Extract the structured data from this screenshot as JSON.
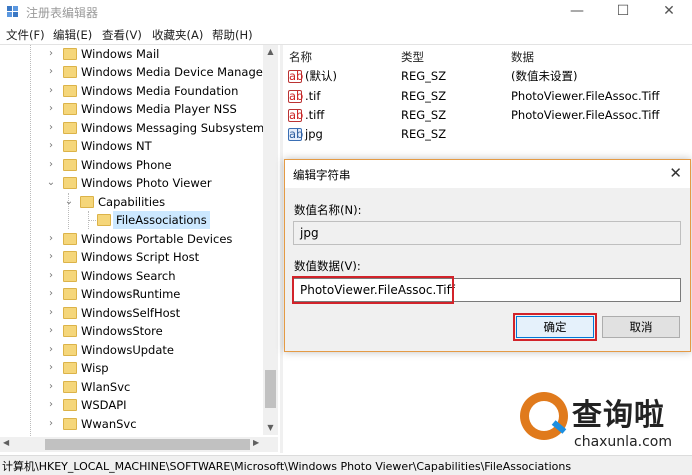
{
  "window": {
    "title": "注册表编辑器",
    "controls": {
      "minimize": "—",
      "maximize": "☐",
      "close": "✕"
    }
  },
  "menu": [
    "文件(F)",
    "编辑(E)",
    "查看(V)",
    "收藏夹(A)",
    "帮助(H)"
  ],
  "tree": {
    "items": [
      {
        "label": "Windows Mail"
      },
      {
        "label": "Windows Media Device Manager"
      },
      {
        "label": "Windows Media Foundation"
      },
      {
        "label": "Windows Media Player NSS"
      },
      {
        "label": "Windows Messaging Subsystem"
      },
      {
        "label": "Windows NT"
      },
      {
        "label": "Windows Phone"
      },
      {
        "label": "Windows Photo Viewer"
      },
      {
        "label": "Capabilities"
      },
      {
        "label": "FileAssociations"
      },
      {
        "label": "Windows Portable Devices"
      },
      {
        "label": "Windows Script Host"
      },
      {
        "label": "Windows Search"
      },
      {
        "label": "WindowsRuntime"
      },
      {
        "label": "WindowsSelfHost"
      },
      {
        "label": "WindowsStore"
      },
      {
        "label": "WindowsUpdate"
      },
      {
        "label": "Wisp"
      },
      {
        "label": "WlanSvc"
      },
      {
        "label": "WSDAPI"
      },
      {
        "label": "WwanSvc"
      }
    ]
  },
  "list": {
    "headers": {
      "name": "名称",
      "type": "类型",
      "data": "数据"
    },
    "rows": [
      {
        "name": "(默认)",
        "type": "REG_SZ",
        "data": "(数值未设置)",
        "icon": "ab"
      },
      {
        "name": ".tif",
        "type": "REG_SZ",
        "data": "PhotoViewer.FileAssoc.Tiff",
        "icon": "ab"
      },
      {
        "name": ".tiff",
        "type": "REG_SZ",
        "data": "PhotoViewer.FileAssoc.Tiff",
        "icon": "ab"
      },
      {
        "name": "jpg",
        "type": "REG_SZ",
        "data": "",
        "icon": "binary"
      }
    ]
  },
  "status": {
    "path": "计算机\\HKEY_LOCAL_MACHINE\\SOFTWARE\\Microsoft\\Windows Photo Viewer\\Capabilities\\FileAssociations"
  },
  "dialog": {
    "title": "编辑字符串",
    "close": "✕",
    "name_label": "数值名称(N):",
    "name_value": "jpg",
    "data_label": "数值数据(V):",
    "data_value": "PhotoViewer.FileAssoc.Tiff",
    "ok": "确定",
    "cancel": "取消"
  },
  "watermark": {
    "text": "查询啦",
    "sub": "chaxunla.com"
  },
  "colors": {
    "highlight_red": "#d2232a",
    "selection": "#cce8ff",
    "dialog_border": "#e49a44",
    "watermark_orange": "#e07a1c"
  }
}
